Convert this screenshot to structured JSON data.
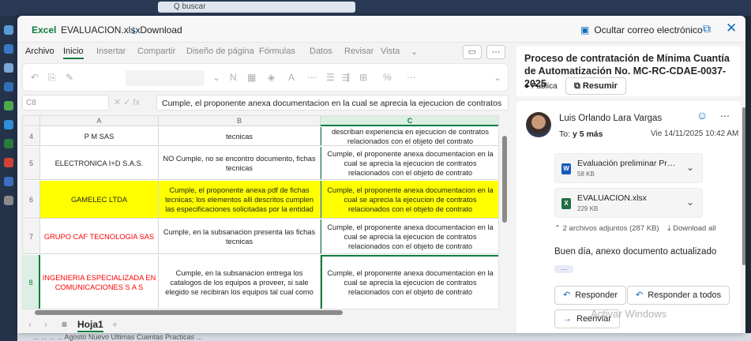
{
  "background": {
    "search_placeholder": "Q buscar",
    "bottom_text": "... ... ... ...  Agosto  Nuevo  Ultimas  Cuentas  Practicas ..."
  },
  "titlebar": {
    "app": "Excel",
    "filename": "EVALUACION.xlsx",
    "download": "Download",
    "hide_email": "Ocultar correo electrónico"
  },
  "excel": {
    "menu": [
      "Archivo",
      "Inicio",
      "Insertar",
      "Compartir",
      "Diseño de página",
      "Fórmulas",
      "Datos",
      "Revisar",
      "Vista"
    ],
    "namebox": "C8",
    "formula": "Cumple, el proponente anexa documentacion en la cual se aprecia la ejecucion de contratos",
    "columns": [
      "A",
      "B",
      "C"
    ],
    "rows": [
      {
        "num": "4",
        "a": "P M SAS",
        "b": "tecnicas",
        "c": "describan experiencia en ejecucion de contratos relacionados con el objeto del contrato"
      },
      {
        "num": "5",
        "a": "ELECTRONICA I+D S.A.S.",
        "b": "NO Cumple, no se encontro documento, fichas tecnicas",
        "c": "Cumple, el proponente anexa documentacion en la cual se aprecia la ejecucion de contratos relacionados con el objeto de contrato"
      },
      {
        "num": "6",
        "a": "GAMELEC LTDA",
        "b": "Cumple, el proponente anexa pdf de fichas tecnicas; los elementos alli descritos cumplen las especificaciones solicitadas por la entidad",
        "c": "Cumple, el proponente anexa documentacion en la cual se aprecia la ejecucion de contratos relacionados con el objeto de contrato"
      },
      {
        "num": "7",
        "a": "GRUPO CAF TECNOLOGIA SAS",
        "b": "Cumple, en la subsanacion presenta las fichas tecnicas",
        "c": "Cumple, el proponente anexa documentacion en la cual se aprecia la ejecucion de contratos relacionados con el objeto de contrato"
      },
      {
        "num": "8",
        "a": "INGENIERIA ESPECIALIZADA EN COMUNICACIONES S A S",
        "b": "Cumple, en la subsanacion entrega los catalogos de los equipos a proveer, si sale elegido se recibiran los equipos tal cual como",
        "c": "Cumple, el proponente anexa documentacion en la cual se aprecia la ejecucion de contratos relacionados con el objeto de contrato"
      }
    ],
    "sheet": "Hoja1",
    "highlight_color": "#ffff00",
    "red_text_color": "#ff0000"
  },
  "mail": {
    "subject": "Proceso de contratación de Mínima Cuantía de Automatización No. MC-RC-CDAE-0037-2025",
    "visibility": "Pública",
    "summarize": "Resumir",
    "sender": "Luis Orlando Lara Vargas",
    "to_label": "To:",
    "to_value": "y 5 más",
    "date": "Vie 14/11/2025 10:42 AM",
    "attachments": [
      {
        "name": "Evaluación preliminar Proces...",
        "size": "58 KB",
        "type": "word"
      },
      {
        "name": "EVALUACION.xlsx",
        "size": "229 KB",
        "type": "excel"
      }
    ],
    "attachments_summary": "2 archivos adjuntos (287 KB)",
    "download_all": "Download all",
    "body": "Buen día, anexo documento actualizado",
    "reply": "Responder",
    "reply_all": "Responder a todos",
    "forward": "Reenviar",
    "watermark": "Activar Windows"
  }
}
